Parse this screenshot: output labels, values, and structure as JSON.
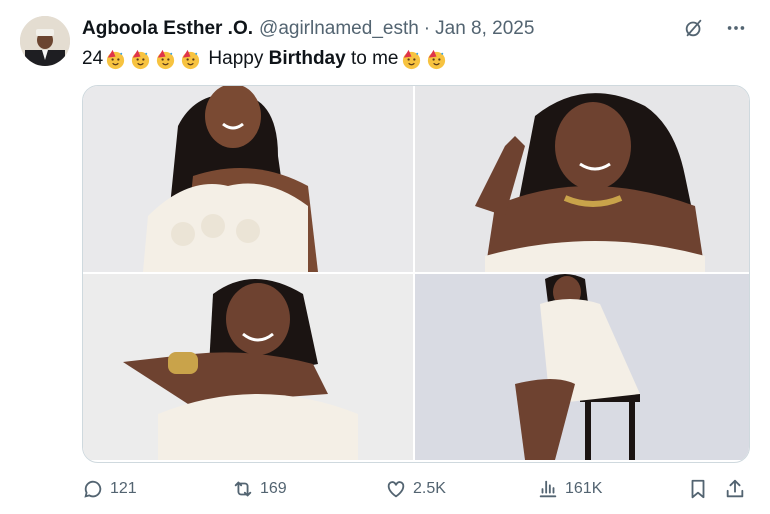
{
  "tweet": {
    "author_name": "Agboola Esther .O.",
    "handle": "@agirlnamed_esth",
    "separator": "·",
    "date": "Jan 8, 2025",
    "text_prefix": "24",
    "text_mid": " Happy ",
    "text_bold": "Birthday",
    "text_suffix": " to me",
    "emoji_name": "partying-face-emoji"
  },
  "header_icons": [
    "grok-icon",
    "more-icon"
  ],
  "photos": [
    {
      "name": "photo-1",
      "description_color": "#e9e9eb"
    },
    {
      "name": "photo-2",
      "description_color": "#e6e6e8"
    },
    {
      "name": "photo-3",
      "description_color": "#ececec"
    },
    {
      "name": "photo-4",
      "description_color": "#d9dbe3"
    }
  ],
  "actions": {
    "replies": "121",
    "reposts": "169",
    "likes": "2.5K",
    "views": "161K"
  },
  "colors": {
    "text": "#0f1419",
    "muted": "#536471",
    "border": "#cfd9de"
  }
}
